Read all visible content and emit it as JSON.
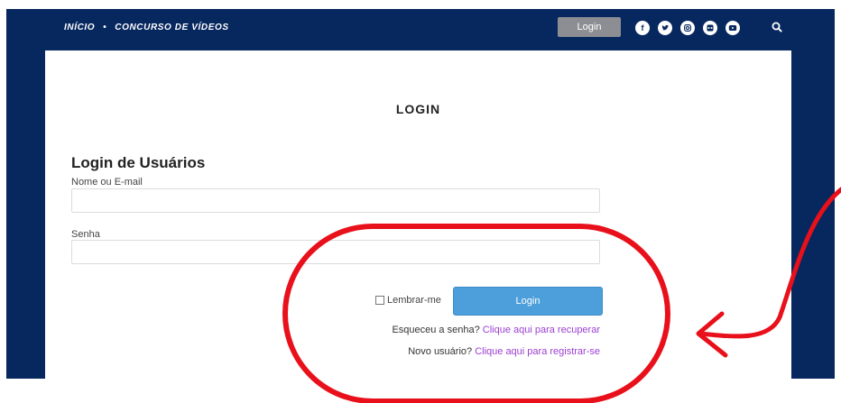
{
  "header": {
    "breadcrumb_home": "INÍCIO",
    "breadcrumb_separator": "•",
    "breadcrumb_current": "CONCURSO DE VÍDEOS",
    "login_button": "Login",
    "social_icons": [
      "facebook-icon",
      "twitter-icon",
      "instagram-icon",
      "flickr-icon",
      "youtube-icon"
    ],
    "search_icon": "search-icon"
  },
  "main": {
    "page_title": "LOGIN",
    "form_heading": "Login de Usuários",
    "username_label": "Nome ou E-mail",
    "username_value": "",
    "password_label": "Senha",
    "password_value": "",
    "remember_label": "Lembrar-me",
    "remember_checked": false,
    "login_button": "Login",
    "forgot_text": "Esqueceu a senha?",
    "forgot_link": "Clique aqui para recuperar",
    "register_text": "Novo usuário?",
    "register_link": "Clique aqui para registrar-se"
  },
  "colors": {
    "header_background": "#07275f",
    "login_button": "#4c9fdb",
    "link": "#9b3fd1",
    "annotation": "#e8101a"
  }
}
